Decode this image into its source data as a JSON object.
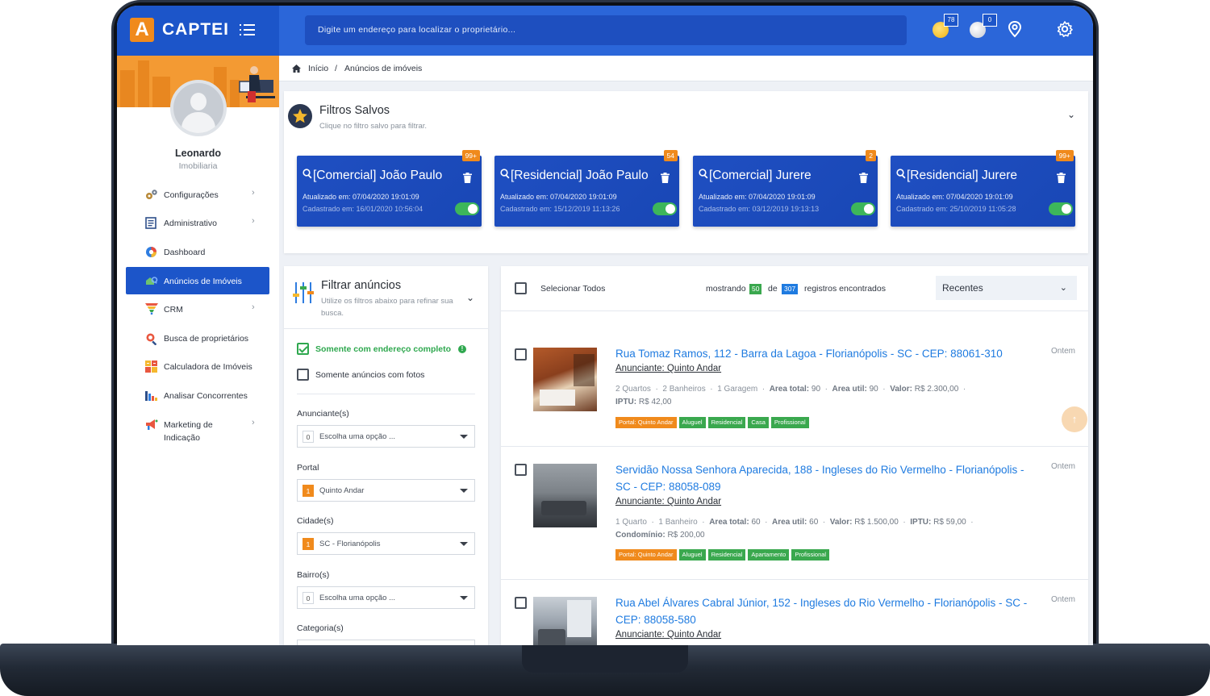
{
  "app": {
    "logo_letter": "A",
    "logo_text": "CAPTEI",
    "search_placeholder": "Digite um endereço para localizar o proprietário...",
    "gold_coins": "78",
    "silver_coins": "0"
  },
  "colors": {
    "primary": "#2b66d9",
    "primary_dark": "#1c55c9",
    "accent": "#f08a1c",
    "success": "#3aa84e",
    "link": "#1f7be0"
  },
  "user": {
    "name": "Leonardo",
    "role": "Imobiliaria"
  },
  "sidebar": {
    "items": [
      {
        "label": "Configurações",
        "icon": "gears-icon",
        "chevron": "›"
      },
      {
        "label": "Administrativo",
        "icon": "clipboard-icon",
        "chevron": "›"
      },
      {
        "label": "Dashboard",
        "icon": "pie-chart-icon",
        "chevron": ""
      },
      {
        "label": "Anúncios de Imóveis",
        "icon": "house-search-icon",
        "chevron": ""
      },
      {
        "label": "CRM",
        "icon": "funnel-icon",
        "chevron": "›"
      },
      {
        "label": "Busca de proprietários",
        "icon": "map-search-icon",
        "chevron": ""
      },
      {
        "label": "Calculadora de Imóveis",
        "icon": "calculator-icon",
        "chevron": ""
      },
      {
        "label": "Analisar Concorrentes",
        "icon": "bar-chart-icon",
        "chevron": ""
      },
      {
        "label": "Marketing de",
        "label2": "Indicação",
        "icon": "megaphone-icon",
        "chevron": "›"
      }
    ]
  },
  "breadcrumb": {
    "home": "Início",
    "sep": "/",
    "current": "Anúncios de imóveis"
  },
  "saved_filters": {
    "title": "Filtros Salvos",
    "subtitle": "Clique no filtro salvo para filtrar.",
    "chevron": "⌄",
    "items": [
      {
        "title": "[Comercial] João Paulo",
        "updated": "Atualizado em: 07/04/2020 19:01:09",
        "created": "Cadastrado em: 16/01/2020 10:56:04",
        "badge": "99+",
        "enabled": true
      },
      {
        "title": "[Residencial] João Paulo",
        "updated": "Atualizado em: 07/04/2020 19:01:09",
        "created": "Cadastrado em: 15/12/2019 11:13:26",
        "badge": "54",
        "enabled": true
      },
      {
        "title": "[Comercial] Jurere",
        "updated": "Atualizado em: 07/04/2020 19:01:09",
        "created": "Cadastrado em: 03/12/2019 19:13:13",
        "badge": "2",
        "enabled": true
      },
      {
        "title": "[Residencial] Jurere",
        "updated": "Atualizado em: 07/04/2020 19:01:09",
        "created": "Cadastrado em: 25/10/2019 11:05:28",
        "badge": "99+",
        "enabled": true
      }
    ]
  },
  "filter_panel": {
    "title": "Filtrar anúncios",
    "subtitle": "Utilize os filtros abaixo para refinar sua busca.",
    "chevron": "⌄",
    "only_complete": "Somente com endereço completo",
    "only_complete_checked": true,
    "only_photos": "Somente anúncios com fotos",
    "only_photos_checked": false,
    "fields": [
      {
        "label": "Anunciante(s)",
        "count": "0",
        "value": "Escolha uma opção ..."
      },
      {
        "label": "Portal",
        "count": "1",
        "value": "Quinto Andar"
      },
      {
        "label": "Cidade(s)",
        "count": "1",
        "value": "SC - Florianópolis"
      },
      {
        "label": "Bairro(s)",
        "count": "0",
        "value": "Escolha uma opção ..."
      },
      {
        "label": "Categoria(s)",
        "count": "",
        "value": ""
      }
    ]
  },
  "listings": {
    "select_all": "Selecionar Todos",
    "showing": "mostrando",
    "shown_count": "50",
    "of": "de",
    "total_count": "307",
    "found": "registros encontrados",
    "sort": "Recentes",
    "sort_chevron": "⌄",
    "scroll_top": "↑",
    "items": [
      {
        "title": "Rua Tomaz Ramos, 112 - Barra da Lagoa - Florianópolis - SC - CEP: 88061-310",
        "advertiser": "Anunciante: Quinto Andar",
        "time": "Ontem",
        "rooms": "2 Quartos",
        "baths": "2 Banheiros",
        "garage": "1 Garagem",
        "area_total_k": "Area total:",
        "area_total_v": "90",
        "area_util_k": "Area util:",
        "area_util_v": "90",
        "valor_k": "Valor:",
        "valor_v": "R$ 2.300,00",
        "extra_k": "IPTU:",
        "extra_v": "R$ 42,00",
        "tags": [
          "Portal: Quinto Andar",
          "Aluguel",
          "Residencial",
          "Casa",
          "Profissional"
        ]
      },
      {
        "title": "Servidão Nossa Senhora Aparecida, 188 - Ingleses do Rio Vermelho - Florianópolis - SC - CEP: 88058-089",
        "advertiser": "Anunciante: Quinto Andar",
        "time": "Ontem",
        "rooms": "1 Quarto",
        "baths": "1 Banheiro",
        "area_total_k": "Area total:",
        "area_total_v": "60",
        "area_util_k": "Area util:",
        "area_util_v": "60",
        "valor_k": "Valor:",
        "valor_v": "R$ 1.500,00",
        "iptu_k": "IPTU:",
        "iptu_v": "R$ 59,00",
        "extra_k": "Condomínio:",
        "extra_v": "R$ 200,00",
        "tags": [
          "Portal: Quinto Andar",
          "Aluguel",
          "Residencial",
          "Apartamento",
          "Profissional"
        ]
      },
      {
        "title": "Rua Abel Álvares Cabral Júnior, 152 - Ingleses do Rio Vermelho - Florianópolis - SC - CEP: 88058-580",
        "advertiser": "Anunciante: Quinto Andar",
        "time": "Ontem"
      }
    ]
  }
}
